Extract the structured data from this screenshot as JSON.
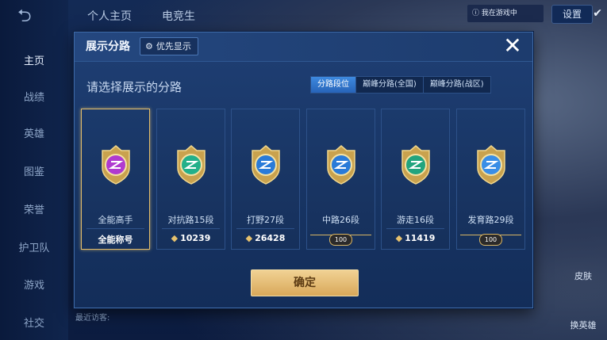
{
  "top": {
    "tabs": [
      "个人主页",
      "电竞生"
    ],
    "settings_label": "设置",
    "status_text": "ⓘ 我在游戏中"
  },
  "sidebar": {
    "items": [
      {
        "label": "主页",
        "active": true
      },
      {
        "label": "战绩"
      },
      {
        "label": "英雄"
      },
      {
        "label": "图鉴"
      },
      {
        "label": "荣誉"
      },
      {
        "label": "护卫队"
      },
      {
        "label": "游戏"
      },
      {
        "label": "社交"
      }
    ]
  },
  "right_actions": [
    "皮肤",
    "换英雄"
  ],
  "bottom": {
    "recent_visitors": "最近访客:"
  },
  "modal": {
    "title": "展示分路",
    "priority_label": "优先显示",
    "close_label": "✕",
    "subtitle": "请选择展示的分路",
    "tabs": [
      {
        "label": "分路段位",
        "active": true
      },
      {
        "label": "巅峰分路(全国)"
      },
      {
        "label": "巅峰分路(战区)"
      }
    ],
    "cards": [
      {
        "name": "全能高手",
        "value": "全能称号",
        "selected": true,
        "color": "#b03ad0",
        "icon": "all-round-emblem-icon"
      },
      {
        "name": "对抗路15段",
        "value": "10239",
        "color": "#23b08a",
        "icon": "clash-lane-emblem-icon"
      },
      {
        "name": "打野27段",
        "value": "26428",
        "color": "#2a7bd8",
        "icon": "jungle-emblem-icon"
      },
      {
        "name": "中路26段",
        "value": "100",
        "badge": true,
        "color": "#2a7bd8",
        "icon": "mid-lane-emblem-icon"
      },
      {
        "name": "游走16段",
        "value": "11419",
        "color": "#22a47e",
        "icon": "roam-emblem-icon"
      },
      {
        "name": "发育路29段",
        "value": "100",
        "badge": true,
        "color": "#3a8ee6",
        "icon": "farm-lane-emblem-icon"
      }
    ],
    "confirm_label": "确定"
  }
}
